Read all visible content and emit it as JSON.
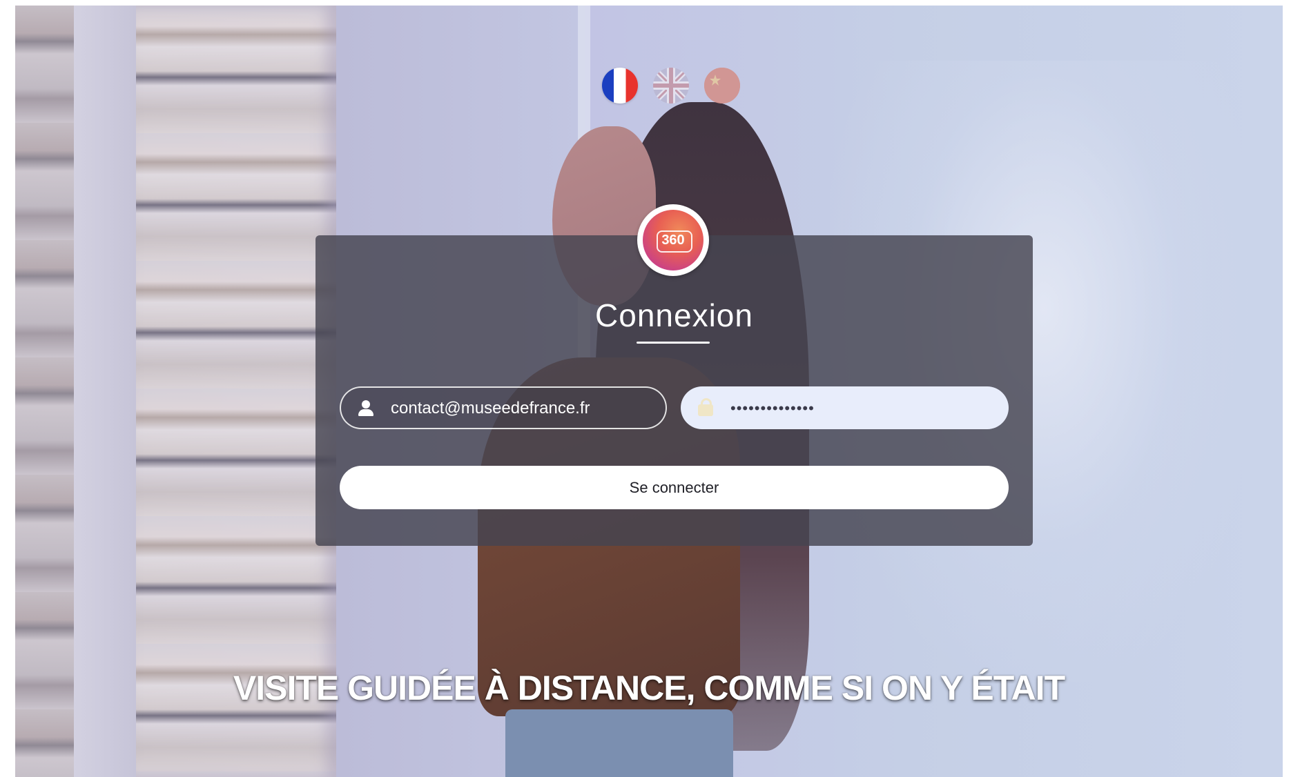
{
  "languages": [
    {
      "code": "fr",
      "icon": "france-flag-icon"
    },
    {
      "code": "en",
      "icon": "uk-flag-icon"
    },
    {
      "code": "zh",
      "icon": "china-flag-icon"
    }
  ],
  "logo": {
    "text": "360",
    "icon": "globe-360-logo"
  },
  "login": {
    "title": "Connexion",
    "email": {
      "value": "contact@museedefrance.fr",
      "icon": "user-icon"
    },
    "password": {
      "value": "••••••••••••••",
      "icon": "lock-icon"
    },
    "submit_label": "Se connecter"
  },
  "tagline": "VISITE GUIDÉE À DISTANCE, COMME SI ON Y ÉTAIT",
  "colors": {
    "card_bg": "#46444f",
    "field_bg": "#e8edfb",
    "accent_logo": "#e85f53"
  }
}
